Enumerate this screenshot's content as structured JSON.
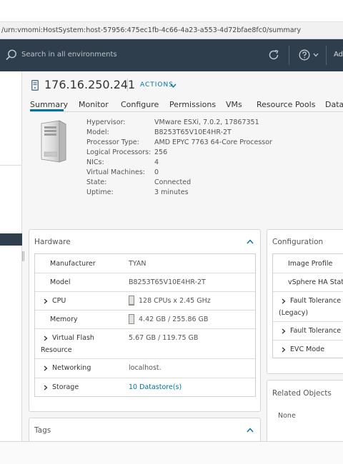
{
  "browser": {
    "url": "/urn:vmomi:HostSystem:host-57956:475ec1fb-4c66-4a23-a553-4d72bfae8fc0/summary"
  },
  "header": {
    "search_placeholder": "Search in all environments",
    "user_label": "Ad",
    "icons": [
      "search-icon",
      "refresh-icon",
      "help-icon",
      "chevron-down-icon"
    ],
    "bg_color": "#2f3e4c"
  },
  "object": {
    "title": "176.16.250.241",
    "actions_label": "ACTIONS",
    "accent_color": "#0072a3"
  },
  "tabs": [
    {
      "label": "Summary",
      "active": true
    },
    {
      "label": "Monitor"
    },
    {
      "label": "Configure"
    },
    {
      "label": "Permissions"
    },
    {
      "label": "VMs"
    },
    {
      "label": "Resource Pools"
    },
    {
      "label": "Datas"
    }
  ],
  "host_info": [
    {
      "label": "Hypervisor:",
      "value": "VMware ESXi, 7.0.2, 17867351"
    },
    {
      "label": "Model:",
      "value": "B8253T65V10E4HR-2T"
    },
    {
      "label": "Processor Type:",
      "value": "AMD EPYC 7763 64-Core Processor"
    },
    {
      "label": "Logical Processors:",
      "value": "256"
    },
    {
      "label": "NICs:",
      "value": "4"
    },
    {
      "label": "Virtual Machines:",
      "value": "0"
    },
    {
      "label": "State:",
      "value": "Connected"
    },
    {
      "label": "Uptime:",
      "value": "3 minutes"
    }
  ],
  "hardware": {
    "title": "Hardware",
    "rows": [
      {
        "label": "Manufacturer",
        "value": "TYAN"
      },
      {
        "label": "Model",
        "value": "B8253T65V10E4HR-2T"
      },
      {
        "label": "CPU",
        "value": "128 CPUs x 2.45 GHz",
        "usage_fraction": 0.05
      },
      {
        "label": "Memory",
        "value": "4.42 GB / 255.86 GB",
        "usage_fraction": 0.02
      },
      {
        "label": "Virtual Flash",
        "label2": "Resource",
        "value": "5.67 GB / 119.75 GB"
      },
      {
        "label": "Networking",
        "value": "localhost."
      },
      {
        "label": "Storage",
        "value": "10 Datastore(s)"
      }
    ]
  },
  "configuration": {
    "title": "Configuration",
    "rows": [
      {
        "label": "Image Profile"
      },
      {
        "label": "vSphere HA State"
      },
      {
        "label": "Fault Tolerance",
        "label2": "(Legacy)"
      },
      {
        "label": "Fault Tolerance"
      },
      {
        "label": "EVC Mode"
      }
    ]
  },
  "tags": {
    "title": "Tags"
  },
  "related": {
    "title": "Related Objects",
    "text": "None"
  }
}
